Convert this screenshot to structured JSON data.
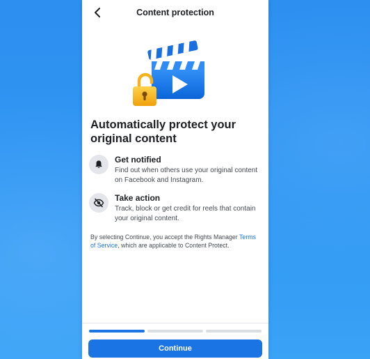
{
  "header": {
    "title": "Content protection",
    "back_icon": "chevron-left-icon"
  },
  "hero": {
    "icon": "clapperboard-lock-illustration"
  },
  "headline": "Automatically protect your original content",
  "features": [
    {
      "icon": "bell-icon",
      "title": "Get notified",
      "description": "Find out when others use your original content on Facebook and Instagram."
    },
    {
      "icon": "eye-slash-icon",
      "title": "Take action",
      "description": "Track, block or get credit for reels that contain your original content."
    }
  ],
  "legal": {
    "before_link": "By selecting Continue, you accept the Rights Manager ",
    "link": "Terms of Service",
    "after_link": ", which are applicable to Content Protect."
  },
  "progress": {
    "step": 1,
    "total": 3
  },
  "cta_label": "Continue",
  "colors": {
    "accent": "#1b74e4",
    "background": "#2f93f2"
  }
}
